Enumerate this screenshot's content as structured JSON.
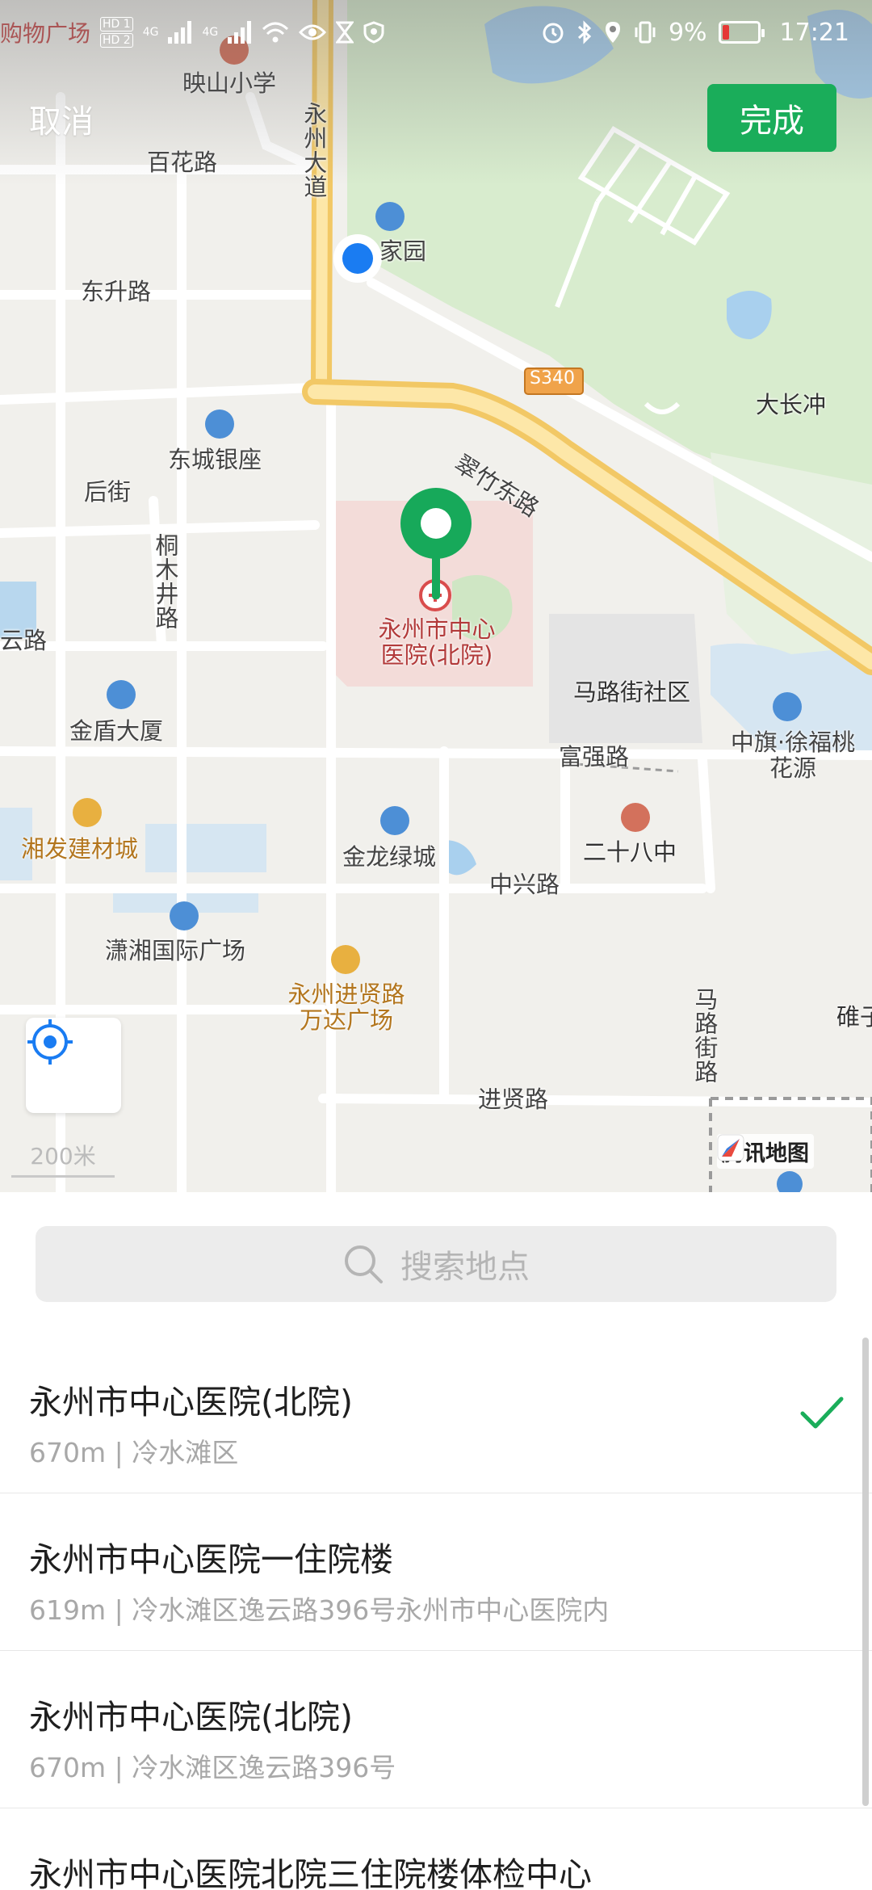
{
  "status_bar": {
    "left_text": "购物广场",
    "hd1": "HD 1",
    "hd2": "HD 2",
    "net1": "4G",
    "net2": "4G",
    "battery_percent_text": "9%",
    "battery_level": 0.09,
    "time": "17:21"
  },
  "header": {
    "cancel_label": "取消",
    "done_label": "完成"
  },
  "map": {
    "labels": {
      "yingshan_school": "映山小学",
      "yongzhou_avenue": "永州大道",
      "baihua_road": "百花路",
      "jiayuan": "家园",
      "dongsheng_road": "东升路",
      "s340": "S340",
      "dachang_chong": "大长冲",
      "dongcheng_yinzuo": "东城银座",
      "cuizhu_east_road": "翠竹东路",
      "hou_street": "后街",
      "tongmujing_road": "桐木井路",
      "hospital": "永州市中心医院(北院)",
      "yun_road": "云路",
      "malujie_community": "马路街社区",
      "jindun_building": "金盾大厦",
      "fuqiang_road": "富强路",
      "zhongqi_xufu": "中旗·徐福桃花源",
      "xiangfa_market": "湘发建材城",
      "jinlong_lvcheng": "金龙绿城",
      "school_28": "二十八中",
      "zhongxing_road": "中兴路",
      "xiaoxiang_plaza": "潇湘国际广场",
      "wanda_plaza": "永州进贤路万达广场",
      "malujie_road": "马路街路",
      "jinxian_road": "进贤路",
      "bei": "碓子"
    },
    "scale_text": "200米",
    "logo_text": "腾讯地图"
  },
  "search": {
    "placeholder": "搜索地点"
  },
  "results": [
    {
      "title": "永州市中心医院(北院)",
      "subtitle": "670m | 冷水滩区",
      "selected": true
    },
    {
      "title": "永州市中心医院一住院楼",
      "subtitle": "619m | 冷水滩区逸云路396号永州市中心医院内",
      "selected": false
    },
    {
      "title": "永州市中心医院(北院)",
      "subtitle": "670m | 冷水滩区逸云路396号",
      "selected": false
    },
    {
      "title": "永州市中心医院北院三住院楼体检中心",
      "subtitle": "",
      "selected": false
    }
  ],
  "colors": {
    "accent_green": "#1aad5a",
    "pin_green": "#17a95a",
    "location_blue": "#1a7cf2"
  }
}
